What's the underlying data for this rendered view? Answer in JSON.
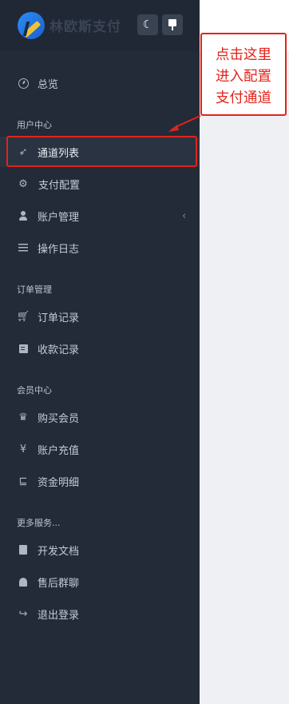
{
  "app": {
    "brand": "林欧斯支付"
  },
  "header": {
    "theme_icon": "moon-icon",
    "pin_icon": "pin-icon"
  },
  "nav": {
    "dashboard": {
      "label": "总览",
      "icon": "dashboard-icon"
    },
    "sections": [
      {
        "title": "用户中心",
        "items": [
          {
            "label": "通道列表",
            "icon": "send-icon",
            "active": true
          },
          {
            "label": "支付配置",
            "icon": "gears-icon"
          },
          {
            "label": "账户管理",
            "icon": "user-icon",
            "has_submenu": true
          },
          {
            "label": "操作日志",
            "icon": "list-icon"
          }
        ]
      },
      {
        "title": "订单管理",
        "items": [
          {
            "label": "订单记录",
            "icon": "cart-icon"
          },
          {
            "label": "收款记录",
            "icon": "receipt-icon"
          }
        ]
      },
      {
        "title": "会员中心",
        "items": [
          {
            "label": "购买会员",
            "icon": "crown-icon"
          },
          {
            "label": "账户充值",
            "icon": "yen-icon"
          },
          {
            "label": "资金明细",
            "icon": "chart-icon"
          }
        ]
      },
      {
        "title": "更多服务...",
        "items": [
          {
            "label": "开发文档",
            "icon": "book-icon"
          },
          {
            "label": "售后群聊",
            "icon": "bell-icon"
          },
          {
            "label": "退出登录",
            "icon": "logout-icon"
          }
        ]
      }
    ]
  },
  "annotation": {
    "lines": [
      "点击这里",
      "进入配置",
      "支付通道"
    ],
    "color": "#e2231a"
  },
  "colors": {
    "sidebar_bg": "#232b38",
    "active_bg": "#2a3342",
    "content_bg": "#eef0f3"
  }
}
